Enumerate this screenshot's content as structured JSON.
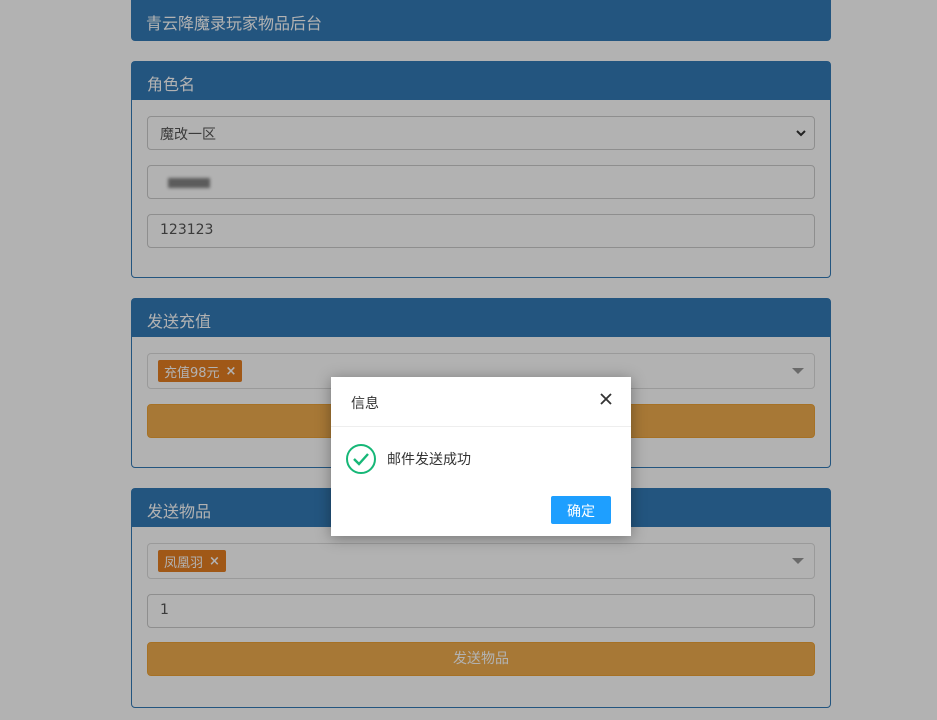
{
  "header": {
    "title": "青云降魔录玩家物品后台"
  },
  "role_panel": {
    "title": "角色名",
    "server_select": {
      "value": "魔改一区"
    },
    "account_input": {
      "value": ""
    },
    "password_input": {
      "value": "123123"
    }
  },
  "recharge_panel": {
    "title": "发送充值",
    "selected_tag": "充值98元",
    "tag_remove": "×",
    "submit_label": ""
  },
  "item_panel": {
    "title": "发送物品",
    "selected_tag": "凤凰羽",
    "tag_remove": "×",
    "quantity": "1",
    "submit_label": "发送物品"
  },
  "dialog": {
    "title": "信息",
    "message": "邮件发送成功",
    "ok_label": "确定",
    "icon": "success-check-icon",
    "close_icon": "close-icon"
  },
  "colors": {
    "primary": "#337ab7",
    "warning": "#f0ad4e",
    "tag": "#e67e22",
    "dialog_button": "#1e9fff",
    "success": "#16b777"
  }
}
